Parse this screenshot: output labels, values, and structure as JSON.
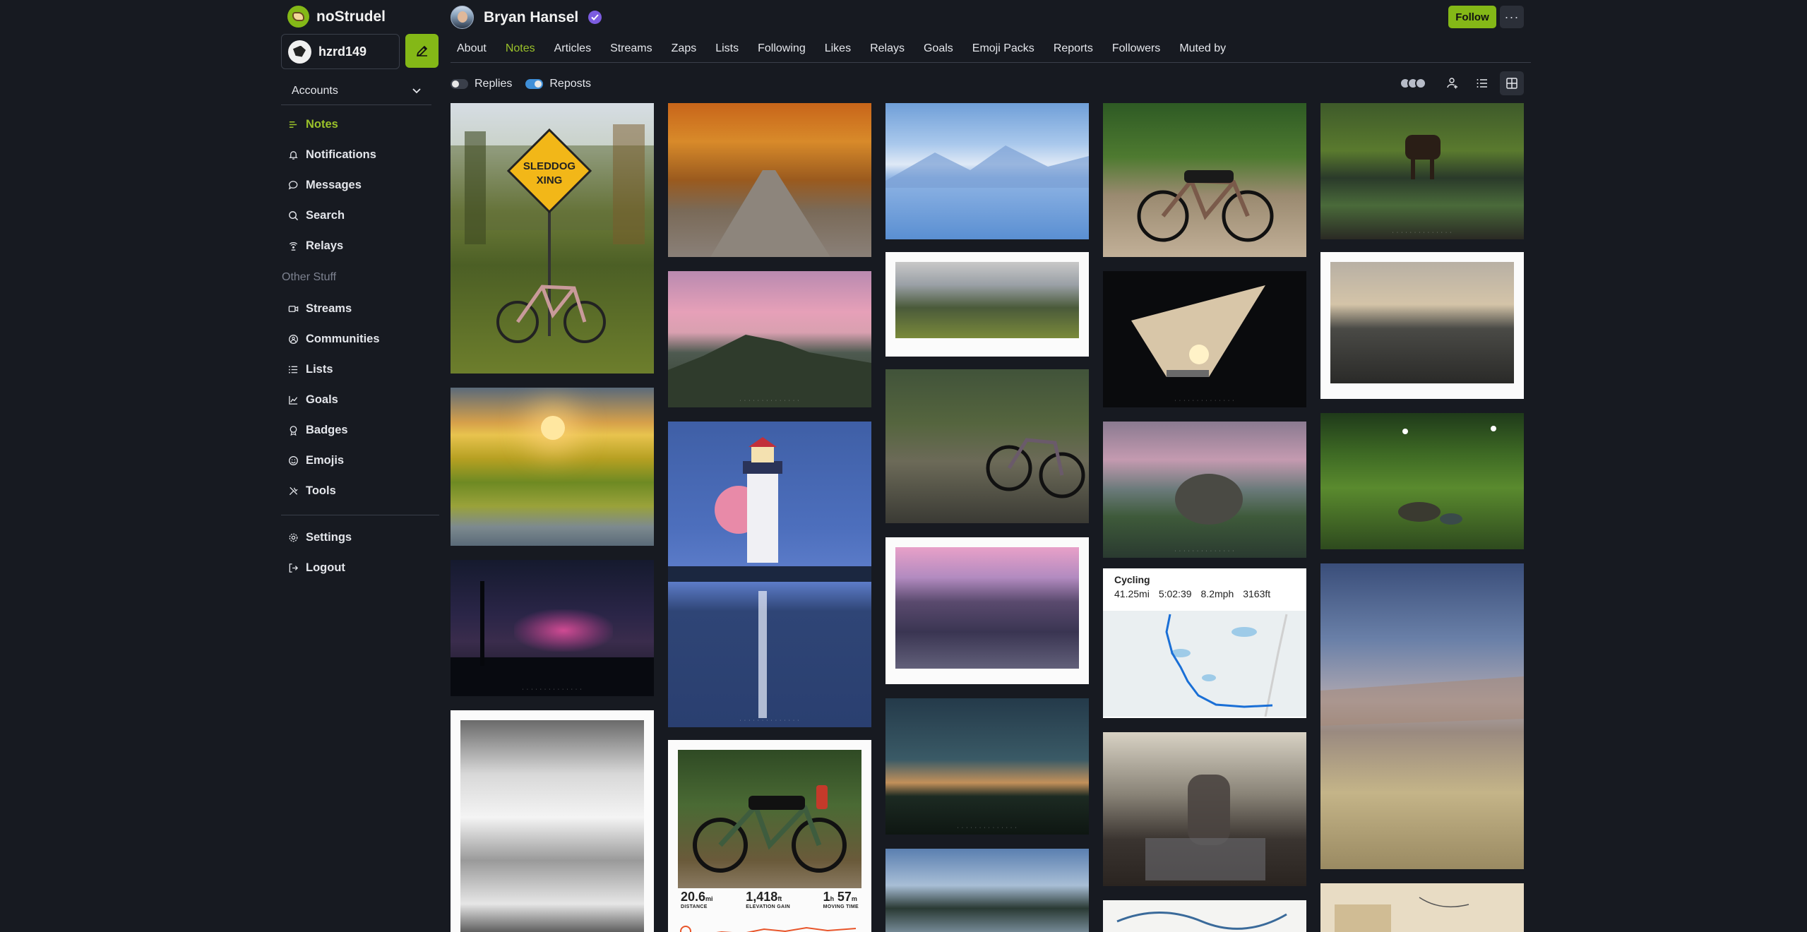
{
  "app": {
    "name": "noStrudel"
  },
  "account": {
    "username": "hzrd149",
    "accounts_label": "Accounts"
  },
  "nav": {
    "items": [
      {
        "label": "Notes",
        "icon": "notes-icon"
      },
      {
        "label": "Notifications",
        "icon": "bell-icon"
      },
      {
        "label": "Messages",
        "icon": "message-icon"
      },
      {
        "label": "Search",
        "icon": "search-icon"
      },
      {
        "label": "Relays",
        "icon": "relay-icon"
      }
    ],
    "other_heading": "Other Stuff",
    "other_items": [
      {
        "label": "Streams",
        "icon": "video-icon"
      },
      {
        "label": "Communities",
        "icon": "communities-icon"
      },
      {
        "label": "Lists",
        "icon": "list-icon"
      },
      {
        "label": "Goals",
        "icon": "chart-icon"
      },
      {
        "label": "Badges",
        "icon": "badge-icon"
      },
      {
        "label": "Emojis",
        "icon": "emoji-icon"
      },
      {
        "label": "Tools",
        "icon": "tools-icon"
      }
    ],
    "bottom_items": [
      {
        "label": "Settings",
        "icon": "gear-icon"
      },
      {
        "label": "Logout",
        "icon": "logout-icon"
      }
    ]
  },
  "profile": {
    "name": "Bryan Hansel",
    "follow_label": "Follow",
    "more_label": "···"
  },
  "tabs": [
    "About",
    "Notes",
    "Articles",
    "Streams",
    "Zaps",
    "Lists",
    "Following",
    "Likes",
    "Relays",
    "Goals",
    "Emoji Packs",
    "Reports",
    "Followers",
    "Muted by"
  ],
  "active_tab": "Notes",
  "filters": {
    "replies_label": "Replies",
    "replies_on": false,
    "reposts_label": "Reposts",
    "reposts_on": true
  },
  "cycling_card": {
    "title": "Cycling",
    "distance": "41.25mi",
    "duration": "5:02:39",
    "speed": "8.2mph",
    "elevation": "3163ft"
  },
  "ride_card": {
    "distance_value": "20.6",
    "distance_unit": "mi",
    "distance_label": "DISTANCE",
    "elev_value": "1,418",
    "elev_unit": "ft",
    "elev_label": "ELEVATION GAIN",
    "time_h": "1",
    "time_h_unit": "h",
    "time_m": "57",
    "time_m_unit": "m",
    "time_label": "MOVING TIME"
  },
  "sign_text": "SLEDDOG XING",
  "colors": {
    "accent": "#84b817",
    "accent_text": "#9bc22a",
    "background": "#171a21",
    "toggle_on": "#3f8fd8"
  }
}
